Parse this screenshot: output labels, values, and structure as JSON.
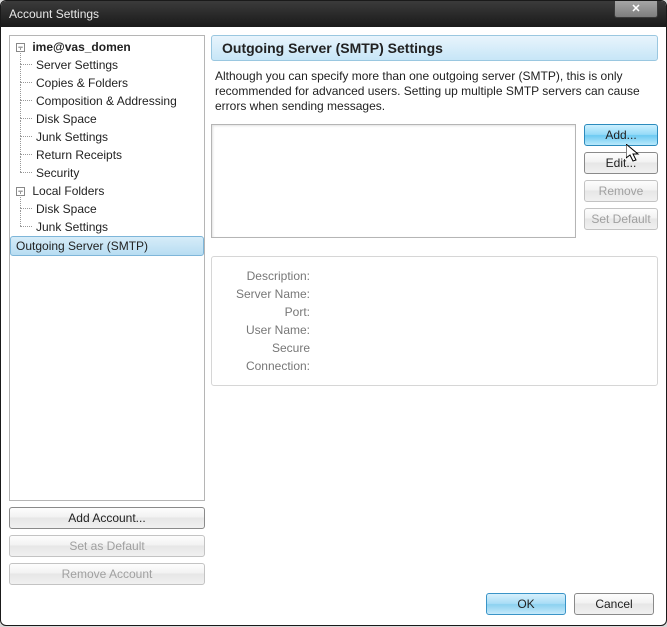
{
  "window": {
    "title": "Account Settings",
    "close_glyph": "✕"
  },
  "tree": {
    "toggle_minus": "−",
    "account": "ime@vas_domen",
    "account_children": [
      "Server Settings",
      "Copies & Folders",
      "Composition & Addressing",
      "Disk Space",
      "Junk Settings",
      "Return Receipts",
      "Security"
    ],
    "local_folders": "Local Folders",
    "local_children": [
      "Disk Space",
      "Junk Settings"
    ],
    "outgoing": "Outgoing Server (SMTP)"
  },
  "sidebar_buttons": {
    "add_account": "Add Account...",
    "set_default": "Set as Default",
    "remove_account": "Remove Account"
  },
  "main": {
    "title": "Outgoing Server (SMTP) Settings",
    "description": "Although you can specify more than one outgoing server (SMTP), this is only recommended for advanced users. Setting up multiple SMTP servers can cause errors when sending messages.",
    "buttons": {
      "add": "Add...",
      "edit": "Edit...",
      "remove": "Remove",
      "set_default": "Set Default"
    },
    "details": {
      "description_label": "Description:",
      "server_label": "Server Name:",
      "port_label": "Port:",
      "user_label": "User Name:",
      "secure_label": "Secure Connection:"
    }
  },
  "dialog_buttons": {
    "ok": "OK",
    "cancel": "Cancel"
  }
}
